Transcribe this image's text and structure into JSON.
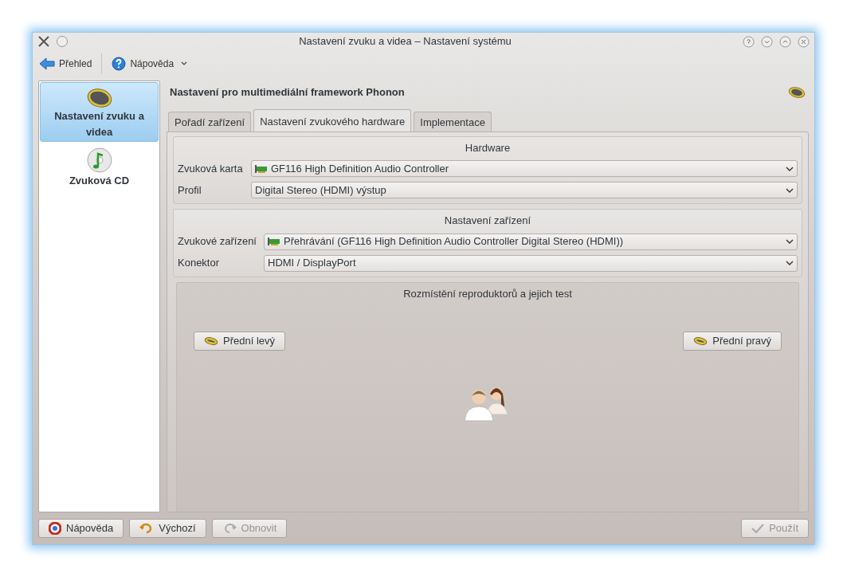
{
  "window": {
    "title": "Nastavení zvuku a videa – Nastavení systému"
  },
  "toolbar": {
    "items": [
      {
        "label": "Přehled",
        "kind": "back"
      },
      {
        "label": "Nápověda",
        "kind": "help"
      }
    ]
  },
  "sidebar": {
    "items": [
      {
        "label": "Nastavení zvuku a videa",
        "selected": true,
        "kind": "speaker"
      },
      {
        "label": "Zvuková CD",
        "selected": false,
        "kind": "cd"
      }
    ]
  },
  "heading": "Nastavení pro multimediální framework Phonon",
  "tabs": [
    {
      "label": "Pořadí zařízení",
      "selected": false
    },
    {
      "label": "Nastavení zvukového hardware",
      "selected": true
    },
    {
      "label": "Implementace",
      "selected": false
    }
  ],
  "hardware": {
    "title": "Hardware",
    "fields": [
      {
        "label": "Zvuková karta",
        "value": "GF116 High Definition Audio Controller",
        "kind": "card"
      },
      {
        "label": "Profil",
        "value": "Digital Stereo (HDMI) výstup",
        "kind": "plain"
      }
    ]
  },
  "device": {
    "title": "Nastavení zařízení",
    "fields": [
      {
        "label": "Zvukové zařízení",
        "value": "Přehrávání (GF116 High Definition Audio Controller Digital Stereo (HDMI))",
        "kind": "card"
      },
      {
        "label": "Konektor",
        "value": "HDMI / DisplayPort",
        "kind": "plain"
      }
    ]
  },
  "speakers": {
    "title": "Rozmístění reproduktorů a jejich test",
    "buttons": [
      "Přední levý",
      "Přední pravý"
    ]
  },
  "buttons": [
    {
      "label": "Nápověda",
      "disabled": false,
      "kind": "help"
    },
    {
      "label": "Výchozí",
      "disabled": false,
      "kind": "default"
    },
    {
      "label": "Obnovit",
      "disabled": true,
      "kind": "reset"
    },
    {
      "label": "Použít",
      "disabled": true,
      "kind": "apply"
    }
  ]
}
